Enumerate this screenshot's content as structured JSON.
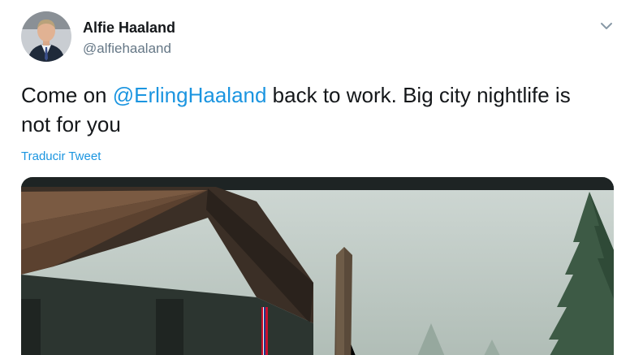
{
  "user": {
    "name": "Alfie Haaland",
    "handle": "@alfiehaaland"
  },
  "tweet": {
    "text_before": "Come on ",
    "mention": "@ErlingHaaland",
    "text_after": " back to work. Big city nightlife is not for you",
    "translate_label": "Traducir Tweet"
  },
  "icons": {
    "menu": "chevron-down-icon"
  },
  "colors": {
    "link": "#1b95e0",
    "text": "#14171a",
    "muted": "#657786"
  }
}
